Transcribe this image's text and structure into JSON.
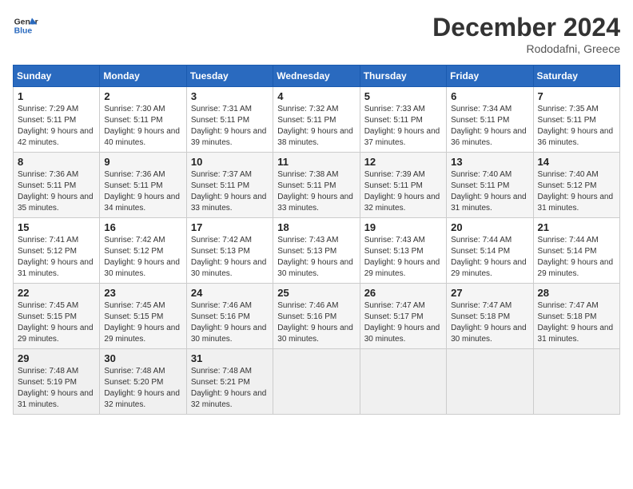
{
  "header": {
    "logo_line1": "General",
    "logo_line2": "Blue",
    "month_title": "December 2024",
    "location": "Rododafni, Greece"
  },
  "weekdays": [
    "Sunday",
    "Monday",
    "Tuesday",
    "Wednesday",
    "Thursday",
    "Friday",
    "Saturday"
  ],
  "weeks": [
    [
      {
        "day": "1",
        "sunrise": "7:29 AM",
        "sunset": "5:11 PM",
        "daylight": "9 hours and 42 minutes."
      },
      {
        "day": "2",
        "sunrise": "7:30 AM",
        "sunset": "5:11 PM",
        "daylight": "9 hours and 40 minutes."
      },
      {
        "day": "3",
        "sunrise": "7:31 AM",
        "sunset": "5:11 PM",
        "daylight": "9 hours and 39 minutes."
      },
      {
        "day": "4",
        "sunrise": "7:32 AM",
        "sunset": "5:11 PM",
        "daylight": "9 hours and 38 minutes."
      },
      {
        "day": "5",
        "sunrise": "7:33 AM",
        "sunset": "5:11 PM",
        "daylight": "9 hours and 37 minutes."
      },
      {
        "day": "6",
        "sunrise": "7:34 AM",
        "sunset": "5:11 PM",
        "daylight": "9 hours and 36 minutes."
      },
      {
        "day": "7",
        "sunrise": "7:35 AM",
        "sunset": "5:11 PM",
        "daylight": "9 hours and 36 minutes."
      }
    ],
    [
      {
        "day": "8",
        "sunrise": "7:36 AM",
        "sunset": "5:11 PM",
        "daylight": "9 hours and 35 minutes."
      },
      {
        "day": "9",
        "sunrise": "7:36 AM",
        "sunset": "5:11 PM",
        "daylight": "9 hours and 34 minutes."
      },
      {
        "day": "10",
        "sunrise": "7:37 AM",
        "sunset": "5:11 PM",
        "daylight": "9 hours and 33 minutes."
      },
      {
        "day": "11",
        "sunrise": "7:38 AM",
        "sunset": "5:11 PM",
        "daylight": "9 hours and 33 minutes."
      },
      {
        "day": "12",
        "sunrise": "7:39 AM",
        "sunset": "5:11 PM",
        "daylight": "9 hours and 32 minutes."
      },
      {
        "day": "13",
        "sunrise": "7:40 AM",
        "sunset": "5:11 PM",
        "daylight": "9 hours and 31 minutes."
      },
      {
        "day": "14",
        "sunrise": "7:40 AM",
        "sunset": "5:12 PM",
        "daylight": "9 hours and 31 minutes."
      }
    ],
    [
      {
        "day": "15",
        "sunrise": "7:41 AM",
        "sunset": "5:12 PM",
        "daylight": "9 hours and 31 minutes."
      },
      {
        "day": "16",
        "sunrise": "7:42 AM",
        "sunset": "5:12 PM",
        "daylight": "9 hours and 30 minutes."
      },
      {
        "day": "17",
        "sunrise": "7:42 AM",
        "sunset": "5:13 PM",
        "daylight": "9 hours and 30 minutes."
      },
      {
        "day": "18",
        "sunrise": "7:43 AM",
        "sunset": "5:13 PM",
        "daylight": "9 hours and 30 minutes."
      },
      {
        "day": "19",
        "sunrise": "7:43 AM",
        "sunset": "5:13 PM",
        "daylight": "9 hours and 29 minutes."
      },
      {
        "day": "20",
        "sunrise": "7:44 AM",
        "sunset": "5:14 PM",
        "daylight": "9 hours and 29 minutes."
      },
      {
        "day": "21",
        "sunrise": "7:44 AM",
        "sunset": "5:14 PM",
        "daylight": "9 hours and 29 minutes."
      }
    ],
    [
      {
        "day": "22",
        "sunrise": "7:45 AM",
        "sunset": "5:15 PM",
        "daylight": "9 hours and 29 minutes."
      },
      {
        "day": "23",
        "sunrise": "7:45 AM",
        "sunset": "5:15 PM",
        "daylight": "9 hours and 29 minutes."
      },
      {
        "day": "24",
        "sunrise": "7:46 AM",
        "sunset": "5:16 PM",
        "daylight": "9 hours and 30 minutes."
      },
      {
        "day": "25",
        "sunrise": "7:46 AM",
        "sunset": "5:16 PM",
        "daylight": "9 hours and 30 minutes."
      },
      {
        "day": "26",
        "sunrise": "7:47 AM",
        "sunset": "5:17 PM",
        "daylight": "9 hours and 30 minutes."
      },
      {
        "day": "27",
        "sunrise": "7:47 AM",
        "sunset": "5:18 PM",
        "daylight": "9 hours and 30 minutes."
      },
      {
        "day": "28",
        "sunrise": "7:47 AM",
        "sunset": "5:18 PM",
        "daylight": "9 hours and 31 minutes."
      }
    ],
    [
      {
        "day": "29",
        "sunrise": "7:48 AM",
        "sunset": "5:19 PM",
        "daylight": "9 hours and 31 minutes."
      },
      {
        "day": "30",
        "sunrise": "7:48 AM",
        "sunset": "5:20 PM",
        "daylight": "9 hours and 32 minutes."
      },
      {
        "day": "31",
        "sunrise": "7:48 AM",
        "sunset": "5:21 PM",
        "daylight": "9 hours and 32 minutes."
      },
      null,
      null,
      null,
      null
    ]
  ],
  "labels": {
    "sunrise": "Sunrise:",
    "sunset": "Sunset:",
    "daylight": "Daylight:"
  }
}
